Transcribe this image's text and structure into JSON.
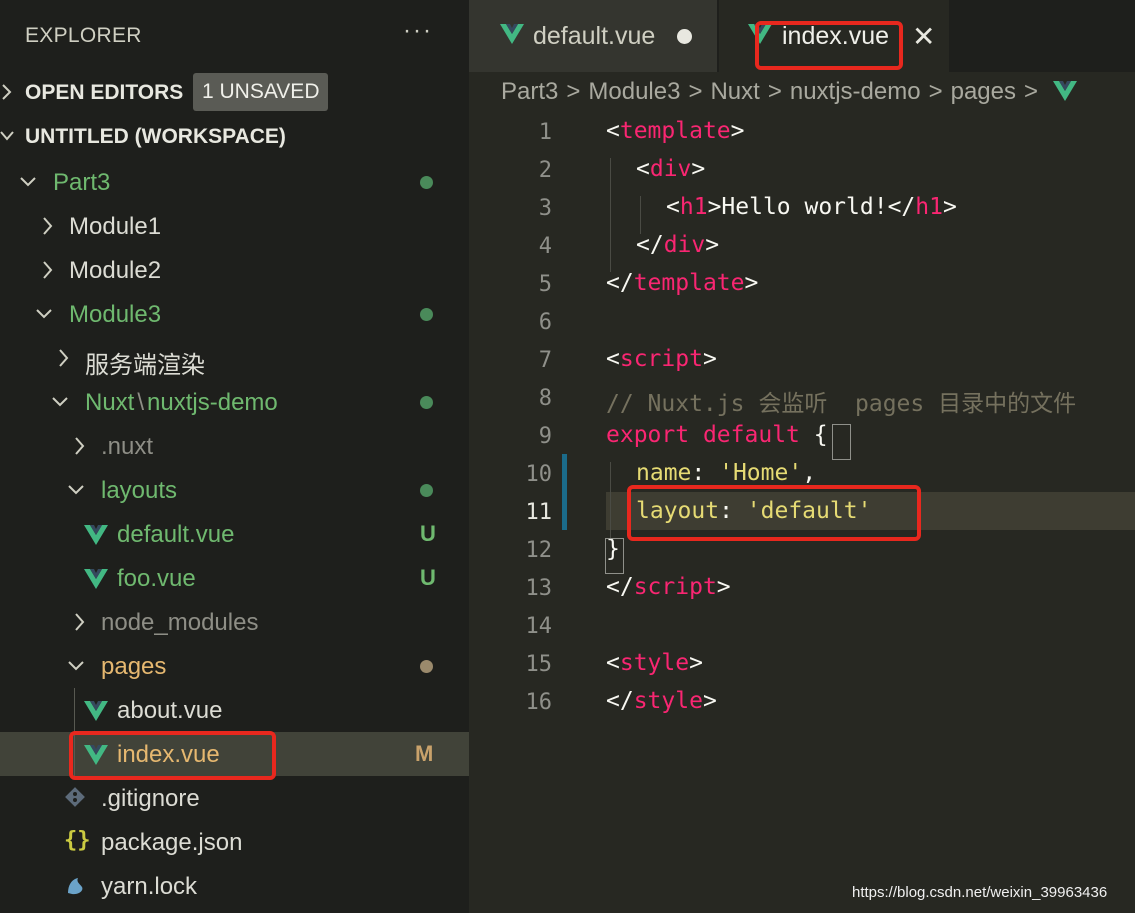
{
  "explorer": {
    "title": "EXPLORER",
    "more_icon": "more-icon",
    "open_editors_label": "OPEN EDITORS",
    "unsaved_badge": "1 UNSAVED",
    "workspace_label": "UNTITLED (WORKSPACE)"
  },
  "tree": {
    "part3": "Part3",
    "module1": "Module1",
    "module2": "Module2",
    "module3": "Module3",
    "ssr_folder": "服务端渲染",
    "nuxt_prefix": "Nuxt",
    "nuxt_sep": "\\",
    "nuxt_demo": "nuxtjs-demo",
    "dot_nuxt": ".nuxt",
    "layouts": "layouts",
    "default_vue": "default.vue",
    "default_status": "U",
    "foo_vue": "foo.vue",
    "foo_status": "U",
    "node_modules": "node_modules",
    "pages": "pages",
    "about_vue": "about.vue",
    "index_vue": "index.vue",
    "index_status": "M",
    "gitignore": ".gitignore",
    "package_json": "package.json",
    "package_icon": "{}",
    "yarn_lock": "yarn.lock"
  },
  "tabs": {
    "tab1_label": "default.vue",
    "tab2_label": "index.vue",
    "close_glyph": "✕"
  },
  "breadcrumb": [
    "Part3",
    "Module3",
    "Nuxt",
    "nuxtjs-demo",
    "pages"
  ],
  "breadcrumb_sep": ">",
  "editor": {
    "line_numbers": [
      "1",
      "2",
      "3",
      "4",
      "5",
      "6",
      "7",
      "8",
      "9",
      "10",
      "11",
      "12",
      "13",
      "14",
      "15",
      "16"
    ],
    "current_line": "11",
    "code": {
      "l1_open": "<",
      "l1_tag": "template",
      "l1_close": ">",
      "l2_open": "<",
      "l2_tag": "div",
      "l2_close": ">",
      "l3_a": "<",
      "l3_tag": "h1",
      "l3_b": ">Hello world!</",
      "l3_tag2": "h1",
      "l3_c": ">",
      "l4_open": "</",
      "l4_tag": "div",
      "l4_close": ">",
      "l5_open": "</",
      "l5_tag": "template",
      "l5_close": ">",
      "l7_open": "<",
      "l7_tag": "script",
      "l7_close": ">",
      "l8_comment": "// Nuxt.js 会监听  pages 目录中的文件",
      "l9_export": "export",
      "l9_default": "default",
      "l9_brace": "{",
      "l10_key": "name",
      "l10_colon": ": ",
      "l10_val": "'Home'",
      "l10_comma": ",",
      "l11_key": "layout",
      "l11_colon": ": ",
      "l11_val": "'default'",
      "l12_brace": "}",
      "l13_open": "</",
      "l13_tag": "script",
      "l13_close": ">",
      "l15_open": "<",
      "l15_tag": "style",
      "l15_close": ">",
      "l16_open": "</",
      "l16_tag": "style",
      "l16_close": ">"
    }
  },
  "watermark": "https://blog.csdn.net/weixin_39963436",
  "colors": {
    "highlight_box": "#e8281e",
    "vue_green": "#42b883",
    "tag_pink": "#f92672",
    "string_yellow": "#e6db74"
  }
}
